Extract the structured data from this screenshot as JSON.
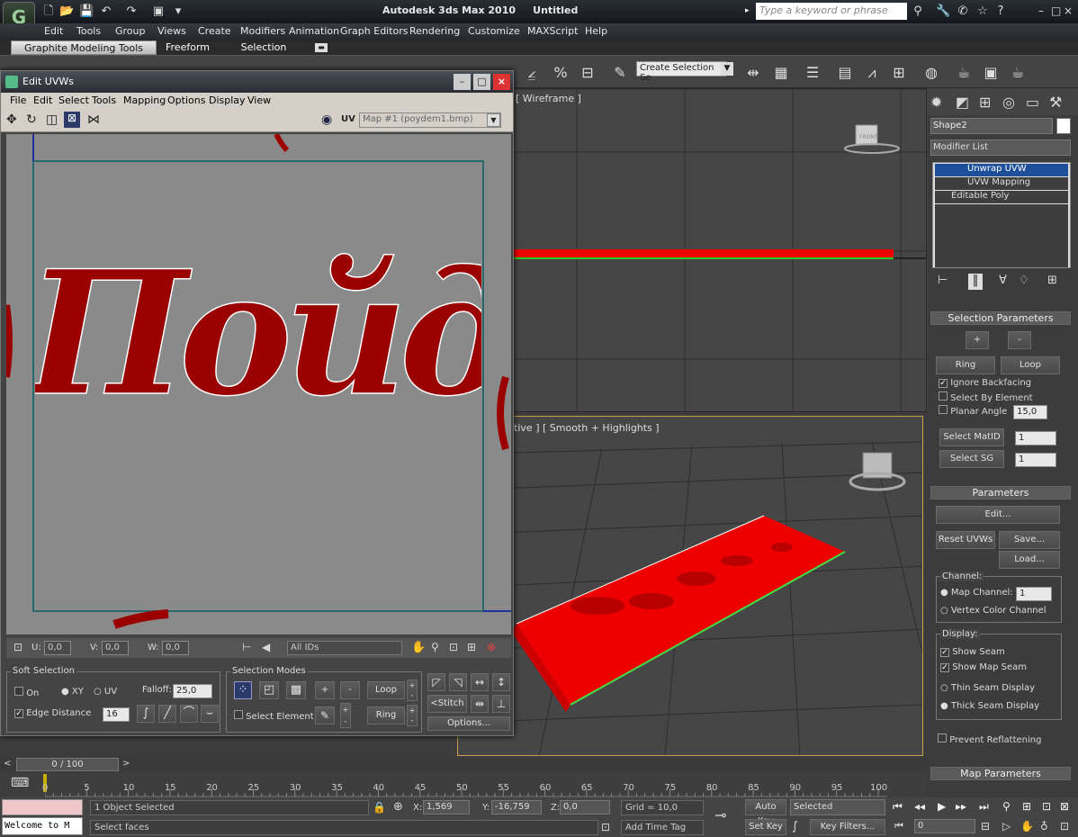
{
  "app": {
    "title": "Autodesk 3ds Max  2010",
    "doc_title": "Untitled",
    "logo": "G",
    "search_placeholder": "Type a keyword or phrase",
    "minimize": "–",
    "maximize": "□",
    "close": "×"
  },
  "menu": [
    "Edit",
    "Tools",
    "Group",
    "Views",
    "Create",
    "Modifiers",
    "Animation",
    "Graph Editors",
    "Rendering",
    "Customize",
    "MAXScript",
    "Help"
  ],
  "ribbon": {
    "tabs": [
      "Graphite Modeling Tools",
      "Freeform",
      "Selection"
    ],
    "active": 0,
    "toggle": "▬"
  },
  "toolbar": {
    "selection_set_placeholder": "Create Selection Se"
  },
  "viewports": {
    "top_label": "[ Wireframe ]",
    "persp_label": "ctive ] [ Smooth + Highlights ]",
    "viewcube_front": "FRONT"
  },
  "command_panel": {
    "object_name": "Shape2",
    "modifier_list": "Modifier List",
    "stack": [
      "Unwrap UVW",
      "UVW Mapping",
      "Editable Poly"
    ],
    "selection_parameters": {
      "title": "Selection Parameters",
      "plus": "+",
      "minus": "-",
      "ring": "Ring",
      "loop": "Loop",
      "ignore_backfacing": "Ignore Backfacing",
      "select_by_element": "Select By Element",
      "planar_angle": "Planar Angle",
      "planar_angle_value": "15,0",
      "select_matid": "Select MatID",
      "matid_value": "1",
      "select_sg": "Select SG",
      "sg_value": "1"
    },
    "parameters": {
      "title": "Parameters",
      "edit": "Edit...",
      "reset_uvws": "Reset UVWs",
      "save": "Save...",
      "load": "Load...",
      "channel_label": "Channel:",
      "map_channel": "Map Channel:",
      "map_channel_value": "1",
      "vertex_color_channel": "Vertex Color Channel",
      "display_label": "Display:",
      "show_seam": "Show Seam",
      "show_map_seam": "Show Map Seam",
      "thin_seam": "Thin Seam Display",
      "thick_seam": "Thick Seam Display",
      "prevent_reflattening": "Prevent Reflattening"
    },
    "map_parameters": "Map Parameters"
  },
  "uvw_editor": {
    "title": "Edit UVWs",
    "menu": [
      "File",
      "Edit",
      "Select",
      "Tools",
      "Mapping",
      "Options",
      "Display",
      "View"
    ],
    "uv_label": "UV",
    "map_dropdown": "Map #1 (poydem1.bmp)",
    "texture_text": "Пойдём!",
    "u_label": "U:",
    "u_value": "0,0",
    "v_label": "V:",
    "v_value": "0,0",
    "w_label": "W:",
    "w_value": "0,0",
    "ids_dropdown": "All IDs",
    "soft_selection": {
      "title": "Soft Selection",
      "on": "On",
      "xy": "XY",
      "uv": "UV",
      "falloff_label": "Falloff:",
      "falloff_value": "25,0",
      "edge_distance": "Edge Distance",
      "edge_distance_value": "16"
    },
    "selection_modes": {
      "title": "Selection Modes",
      "plus": "+",
      "minus": "-",
      "loop": "Loop",
      "ring": "Ring",
      "select_element": "Select Element"
    },
    "stitch": "Stitch",
    "options": "Options..."
  },
  "timeline": {
    "frame_display": "0 / 100",
    "ticks": [
      "0",
      "5",
      "10",
      "15",
      "20",
      "25",
      "30",
      "35",
      "40",
      "45",
      "50",
      "55",
      "60",
      "65",
      "70",
      "75",
      "80",
      "85",
      "90",
      "95",
      "100"
    ]
  },
  "status": {
    "listener": "Welcome to M",
    "objects_selected": "1 Object Selected",
    "prompt": "Select faces",
    "x_label": "X:",
    "x_value": "1,569",
    "y_label": "Y:",
    "y_value": "-16,759",
    "z_label": "Z:",
    "z_value": "0,0",
    "grid": "Grid = 10,0",
    "add_time_tag": "Add Time Tag",
    "auto_key": "Auto Key",
    "set_key": "Set Key",
    "key_mode": "Selected",
    "key_filters": "Key Filters...",
    "current_frame": "0"
  }
}
